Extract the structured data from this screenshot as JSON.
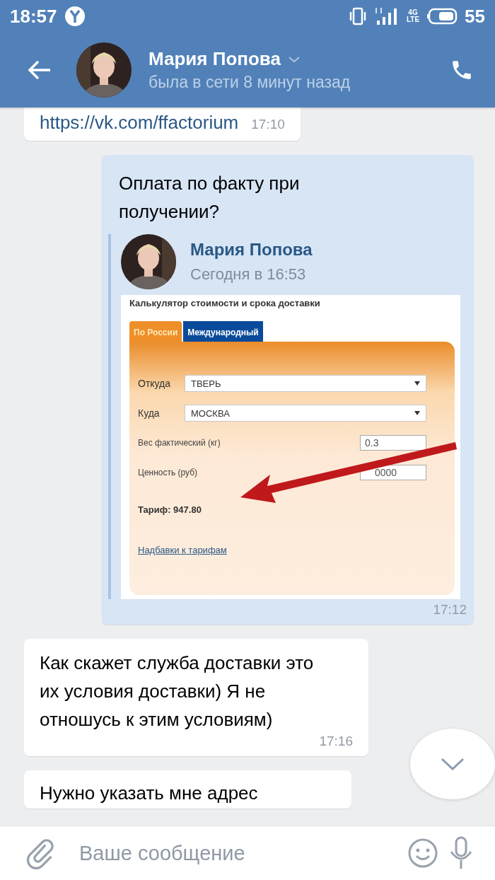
{
  "status_bar": {
    "time": "18:57",
    "network": "4G",
    "network_sub": "LTE",
    "battery": "55"
  },
  "header": {
    "name": "Мария Попова",
    "status": "была в сети 8 минут назад"
  },
  "messages": [
    {
      "kind": "incoming",
      "link": "https://vk.com/ffactorium",
      "time": "17:10"
    },
    {
      "kind": "outgoing",
      "text": "Оплата по факту при получении?",
      "time": "17:12",
      "forward": {
        "name": "Мария Попова",
        "date": "Сегодня в 16:53",
        "calculator": {
          "title": "Калькулятор стоимости и срока доставки",
          "tabs": [
            {
              "label": "По России",
              "selected": true
            },
            {
              "label": "Международный",
              "selected": false
            }
          ],
          "fields": [
            {
              "kind": "select",
              "label": "Откуда",
              "value": "ТВЕРЬ"
            },
            {
              "kind": "select",
              "label": "Куда",
              "value": "МОСКВА"
            },
            {
              "kind": "input",
              "label": "Вес фактический (кг)",
              "value": "0.3"
            },
            {
              "kind": "input",
              "label": "Ценность (руб)",
              "value": "0000"
            }
          ],
          "tariff": "Тариф: 947.80",
          "link": "Надбавки к тарифам"
        }
      }
    },
    {
      "kind": "incoming",
      "text": "Как скажет служба доставки это их условия доставки) Я не отношусь к этим условиям)",
      "time": "17:16"
    },
    {
      "kind": "incoming",
      "text": "Нужно указать мне адрес"
    }
  ],
  "composer": {
    "placeholder": "Ваше сообщение"
  }
}
